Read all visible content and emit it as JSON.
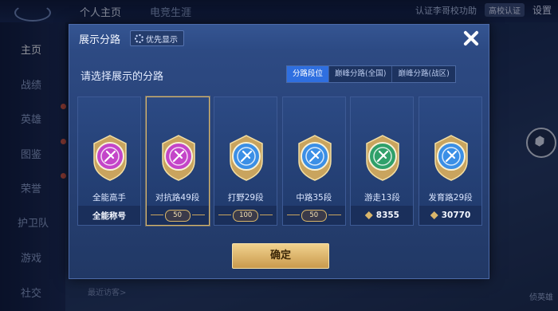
{
  "topbar": {
    "tabs": [
      "个人主页",
      "电竞生涯"
    ],
    "cert_text": "认证李哥校功助",
    "cert_badge": "高校认证",
    "settings": "设置"
  },
  "sidebar": {
    "items": [
      "主页",
      "战绩",
      "英雄",
      "图鉴",
      "荣誉",
      "护卫队",
      "游戏",
      "社交"
    ]
  },
  "bottom_hint": "最近访客>",
  "right_label": "侦英雄",
  "modal": {
    "title": "展示分路",
    "priority_label": "优先显示",
    "prompt": "请选择展示的分路",
    "segments": [
      "分路段位",
      "巅峰分路(全国)",
      "巅峰分路(战区)"
    ],
    "active_segment": 0,
    "confirm_label": "确定",
    "cards": [
      {
        "label": "全能高手",
        "footer": "全能称号",
        "type": "title",
        "color": "#c445c9",
        "icon": "all-round-emblem"
      },
      {
        "label": "对抗路49段",
        "footer": "50",
        "type": "level",
        "color": "#c445c9",
        "icon": "clash-lane-emblem",
        "selected": true
      },
      {
        "label": "打野29段",
        "footer": "100",
        "type": "level",
        "color": "#3b8fe6",
        "icon": "jungle-emblem"
      },
      {
        "label": "中路35段",
        "footer": "50",
        "type": "level",
        "color": "#3b8fe6",
        "icon": "mid-lane-emblem"
      },
      {
        "label": "游走13段",
        "footer": "8355",
        "type": "score",
        "color": "#2fa06a",
        "icon": "roam-emblem"
      },
      {
        "label": "发育路29段",
        "footer": "30770",
        "type": "score",
        "color": "#3b8fe6",
        "icon": "farm-lane-emblem"
      }
    ]
  }
}
